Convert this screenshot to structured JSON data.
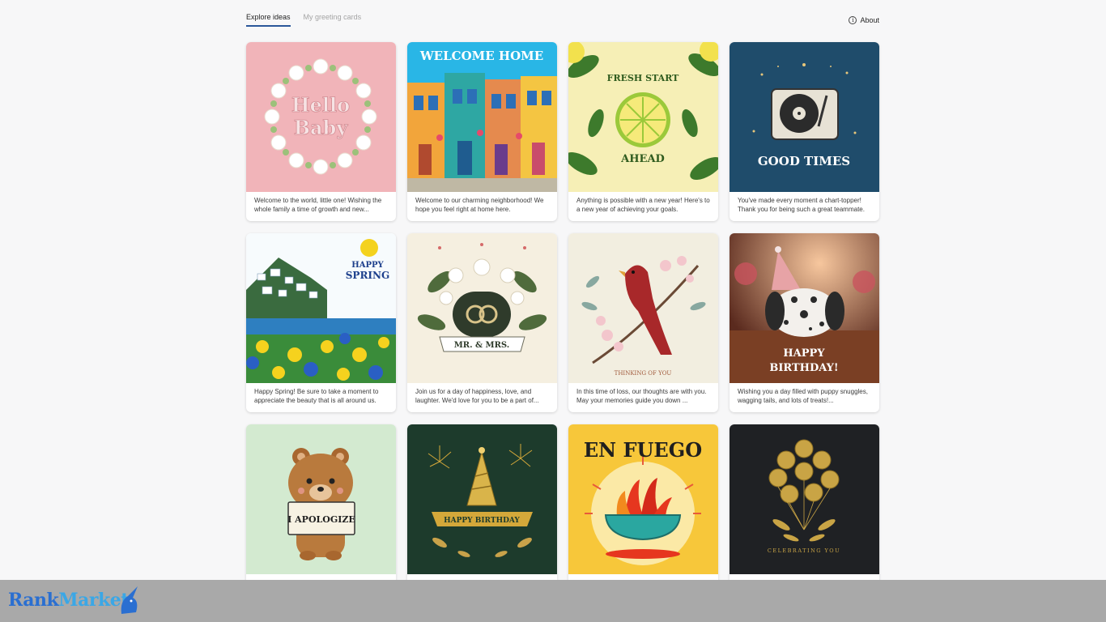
{
  "tabs": [
    {
      "label": "Explore ideas",
      "active": true
    },
    {
      "label": "My greeting cards",
      "active": false
    }
  ],
  "about_label": "About",
  "cards": [
    {
      "art_text": "Hello Baby",
      "caption": "Welcome to the world, little one! Wishing the whole family a time of growth and new..."
    },
    {
      "art_text": "WELCOME HOME",
      "caption": "Welcome to our charming neighborhood! We hope you feel right at home here."
    },
    {
      "art_text": "FRESH START AHEAD",
      "caption": "Anything is possible with a new year! Here's to a new year of achieving your goals."
    },
    {
      "art_text": "GOOD TIMES",
      "caption": "You've made every moment a chart-topper! Thank you for being such a great teammate."
    },
    {
      "art_text": "HAPPY SPRING",
      "caption": "Happy Spring! Be sure to take a moment to appreciate the beauty that is all around us."
    },
    {
      "art_text": "MR. & MRS.",
      "caption": "Join us for a day of happiness, love, and laughter. We'd love for you to be a part of..."
    },
    {
      "art_text": "THINKING OF YOU",
      "caption": "In this time of loss, our thoughts are with you. May your memories guide you down ..."
    },
    {
      "art_text": "HAPPY BIRTHDAY!",
      "caption": "Wishing you a day filled with puppy snuggles, wagging tails, and lots of treats!..."
    },
    {
      "art_text": "I APOLOGIZE",
      "caption": ""
    },
    {
      "art_text": "HAPPY BIRTHDAY",
      "caption": ""
    },
    {
      "art_text": "EN FUEGO",
      "caption": ""
    },
    {
      "art_text": "CELEBRATING YOU",
      "caption": ""
    }
  ],
  "watermark": {
    "part1": "Rank",
    "part2": "Market"
  }
}
